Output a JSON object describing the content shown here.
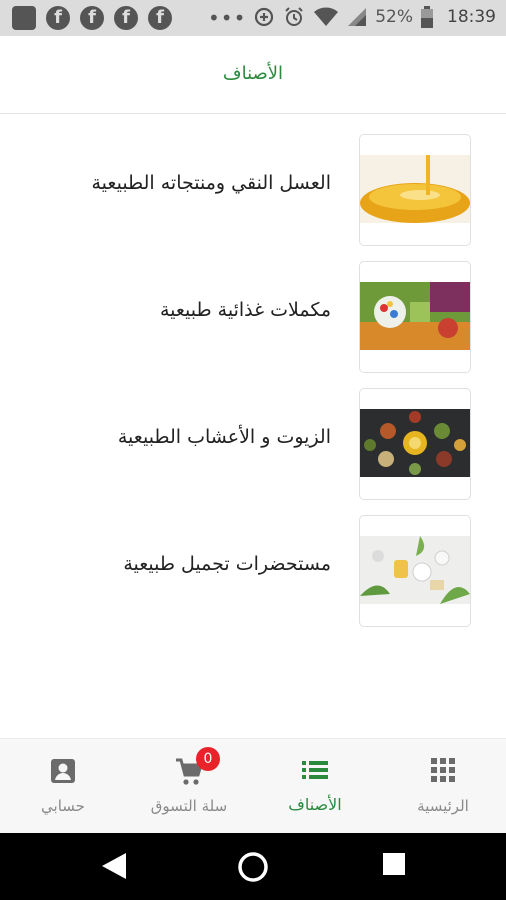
{
  "status_bar": {
    "battery": "52%",
    "time": "18:39"
  },
  "header": {
    "title": "الأصناف"
  },
  "categories": [
    {
      "label": "العسل النقي ومنتجاته الطبيعية",
      "image": "honey-photo"
    },
    {
      "label": "مكملات غذائية طبيعية",
      "image": "vegetables-pills-photo"
    },
    {
      "label": "الزيوت و الأعشاب الطبيعية",
      "image": "spices-herbs-photo"
    },
    {
      "label": "مستحضرات تجميل طبيعية",
      "image": "cosmetics-photo"
    }
  ],
  "bottom_nav": {
    "home": "الرئيسية",
    "categories": "الأصناف",
    "cart": "سلة التسوق",
    "account": "حسابي",
    "cart_count": "0",
    "active_color": "#2a8a3e"
  }
}
